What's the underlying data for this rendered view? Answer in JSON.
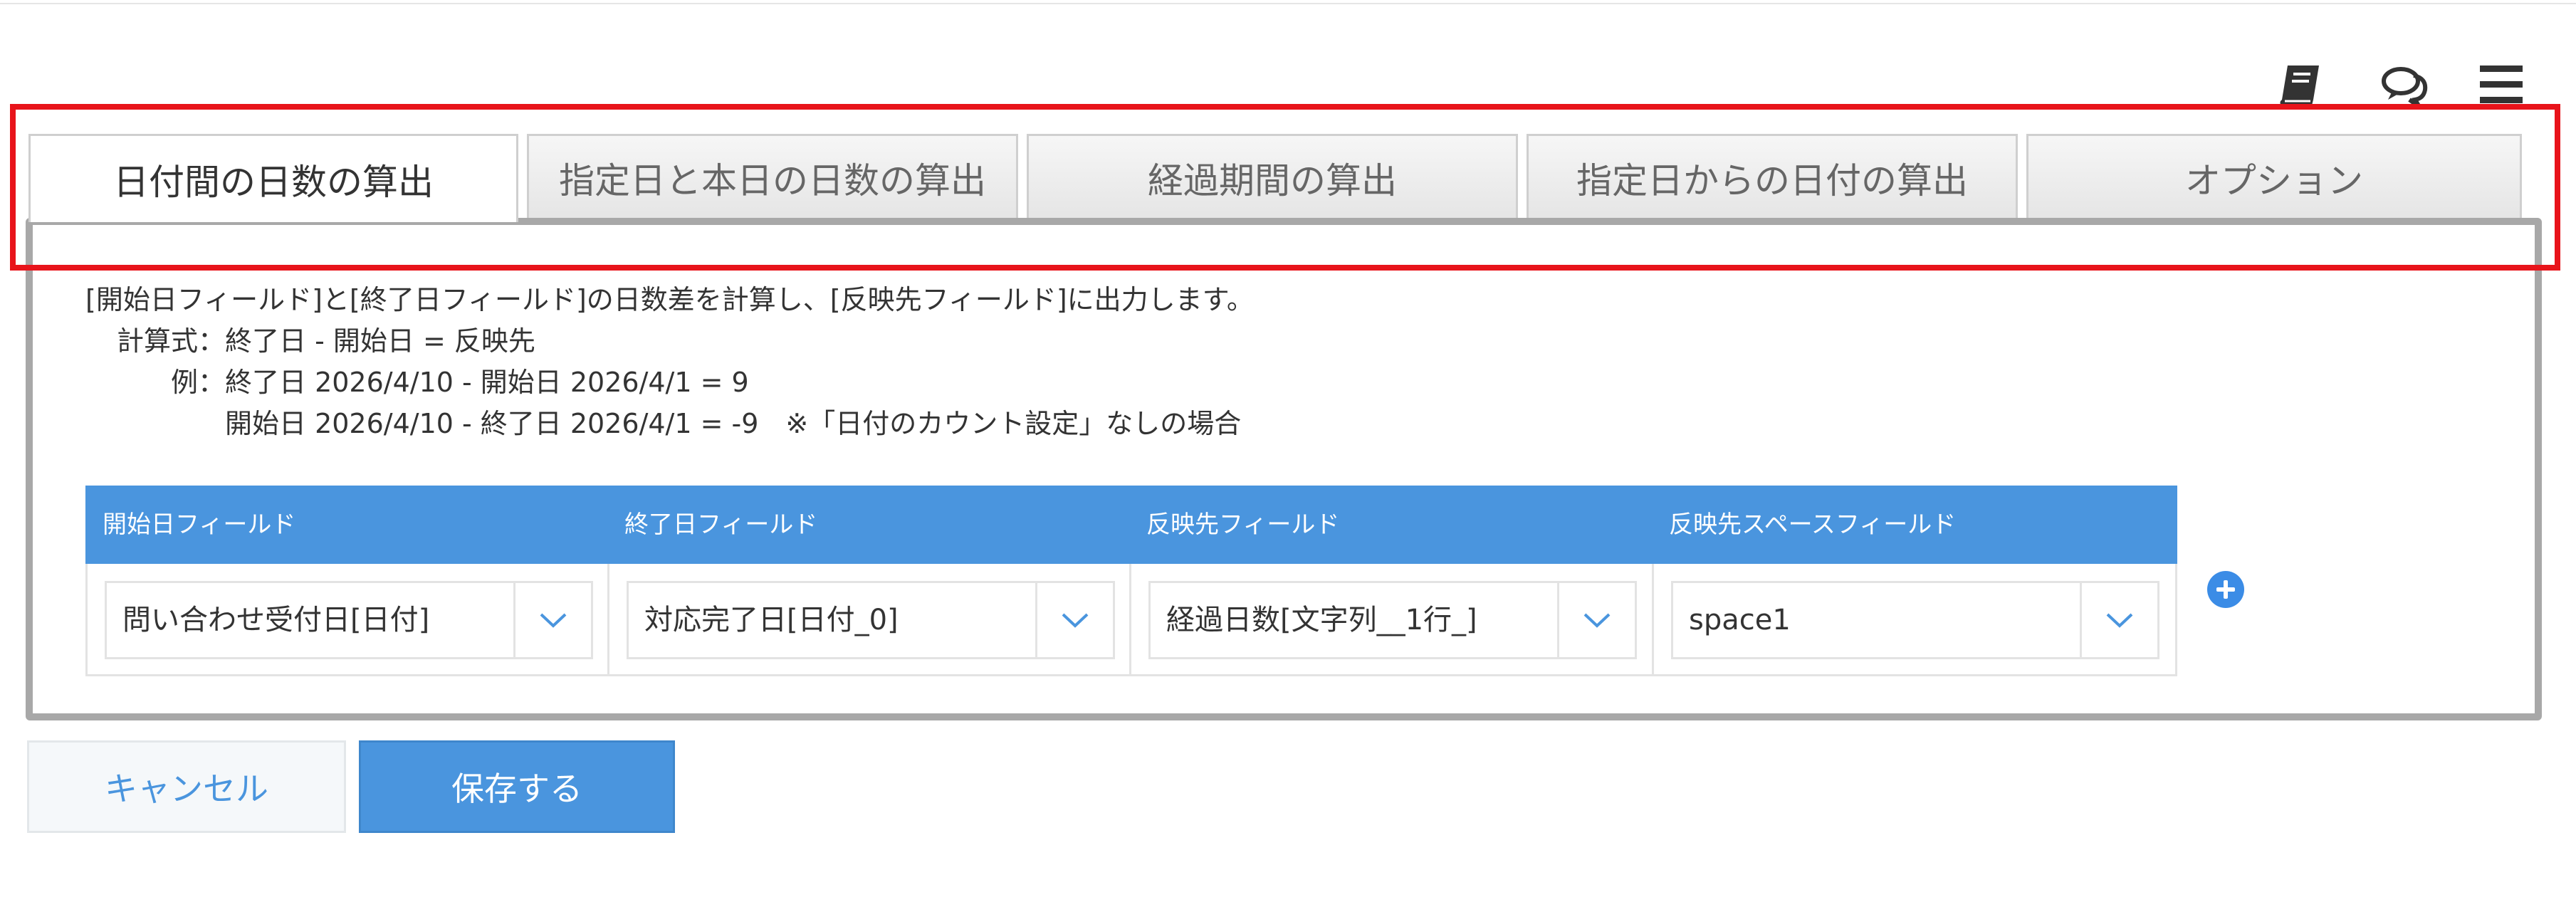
{
  "tabs": [
    {
      "label": "日付間の日数の算出",
      "active": true
    },
    {
      "label": "指定日と本日の日数の算出",
      "active": false
    },
    {
      "label": "経過期間の算出",
      "active": false
    },
    {
      "label": "指定日からの日付の算出",
      "active": false
    },
    {
      "label": "オプション",
      "active": false
    }
  ],
  "header_icons": [
    "book-icon",
    "chat-icon",
    "menu-icon"
  ],
  "description": {
    "summary": "[開始日フィールド]と[終了日フィールド]の日数差を計算し、[反映先フィールド]に出力します。",
    "formula_label": "計算式：",
    "formula": "終了日 - 開始日 = 反映先",
    "example_label": "例：",
    "example1": "終了日 2026/4/10 - 開始日 2026/4/1 = 9",
    "example2": "開始日 2026/4/10 - 終了日 2026/4/1 = -9　※「日付のカウント設定」なしの場合"
  },
  "table": {
    "headers": [
      "開始日フィールド",
      "終了日フィールド",
      "反映先フィールド",
      "反映先スペースフィールド"
    ],
    "row": [
      "問い合わせ受付日[日付]",
      "対応完了日[日付_0]",
      "経過日数[文字列__1行_]",
      "space1"
    ]
  },
  "buttons": {
    "cancel": "キャンセル",
    "save": "保存する"
  },
  "colors": {
    "accent": "#4a95de",
    "highlight": "#e8141b",
    "panel_border": "#a8a8a8"
  }
}
